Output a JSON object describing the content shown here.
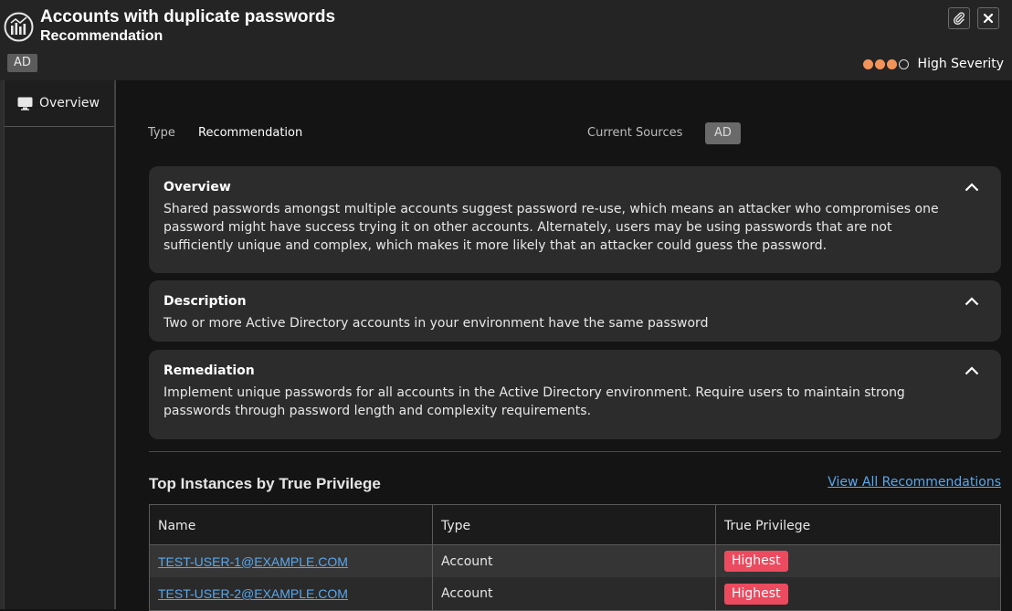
{
  "header": {
    "title": "Accounts with duplicate passwords",
    "subtitle": "Recommendation",
    "source_badge": "AD",
    "severity": {
      "level": 3,
      "max": 4,
      "label": "High Severity",
      "color": "#f2935a"
    }
  },
  "sidebar": {
    "items": [
      {
        "label": "Overview",
        "icon": "monitor-icon"
      }
    ]
  },
  "meta": {
    "type_label": "Type",
    "type_value": "Recommendation",
    "sources_label": "Current Sources",
    "sources_badge": "AD"
  },
  "cards": [
    {
      "title": "Overview",
      "body": "Shared passwords amongst multiple accounts suggest password re-use, which means an attacker who compromises one password might have success trying it on other accounts. Alternately, users may be using passwords that are not sufficiently unique and complex, which makes it more likely that an attacker could guess the password."
    },
    {
      "title": "Description",
      "body": "Two or more Active Directory accounts in your environment have the same password"
    },
    {
      "title": "Remediation",
      "body": "Implement unique passwords for all accounts in the Active Directory environment. Require users to maintain strong passwords through password length and complexity requirements."
    }
  ],
  "instances": {
    "title": "Top Instances by True Privilege",
    "view_all": "View All Recommendations",
    "columns": [
      "Name",
      "Type",
      "True Privilege"
    ],
    "rows": [
      {
        "name": "TEST-USER-1@EXAMPLE.COM",
        "type": "Account",
        "privilege": "Highest"
      },
      {
        "name": "TEST-USER-2@EXAMPLE.COM",
        "type": "Account",
        "privilege": "Highest"
      }
    ]
  }
}
